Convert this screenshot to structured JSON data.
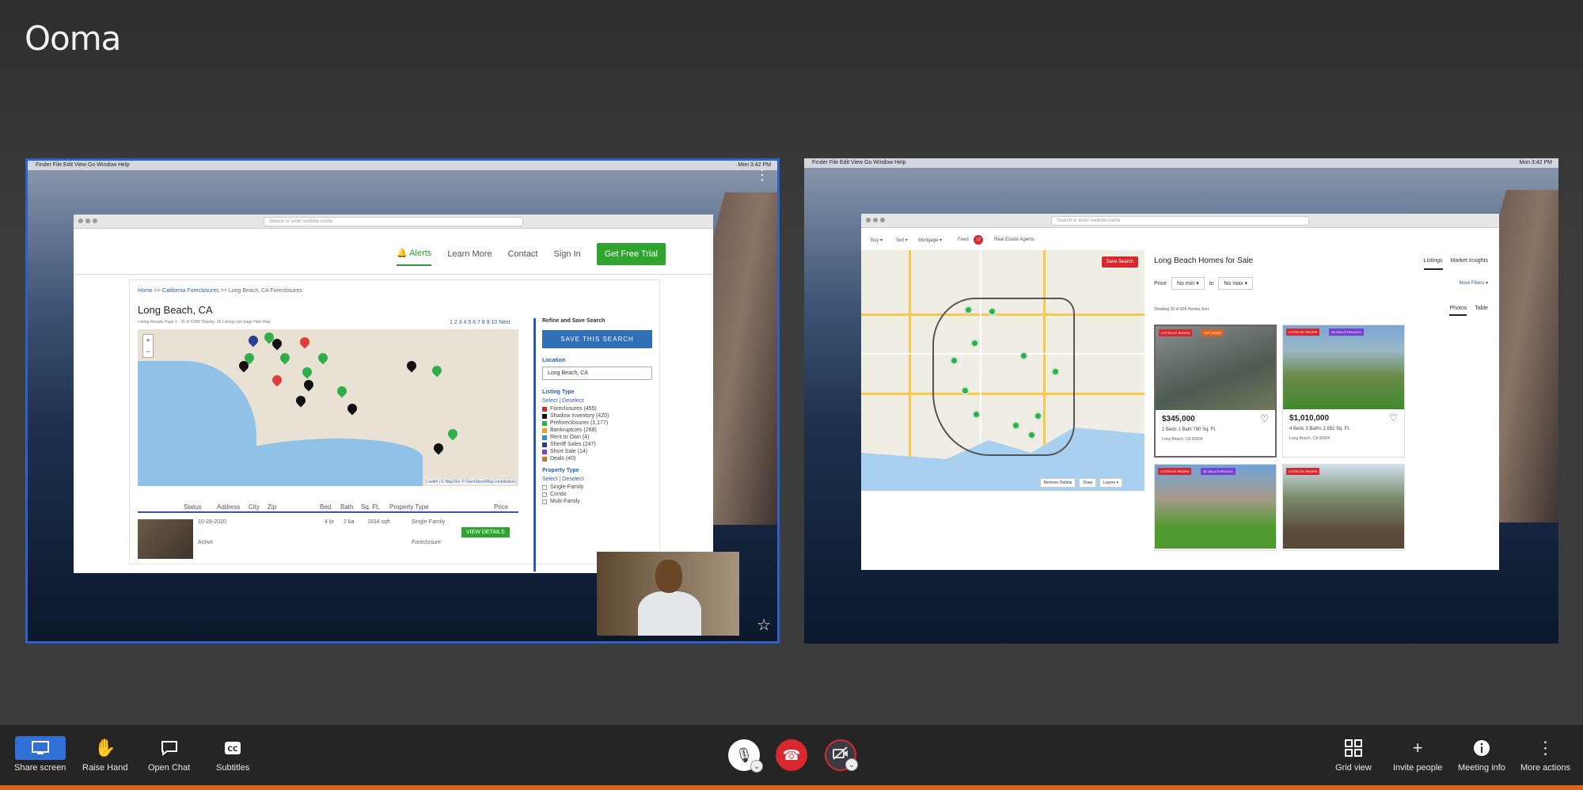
{
  "brand": {
    "logo": "Ooma"
  },
  "left_tile": {
    "menu_bar": "Finder  File  Edit  View  Go  Window  Help",
    "menu_bar_right": "Mon 3:42 PM",
    "url_placeholder": "Search or enter website name",
    "nav": {
      "alerts": "Alerts",
      "learn_more": "Learn More",
      "contact": "Contact",
      "sign_in": "Sign In",
      "cta": "Get Free Trial"
    },
    "breadcrumb": {
      "home": "Home",
      "sep1": ">>",
      "state": "California Foreclosures",
      "sep2": ">>",
      "current": "Long Beach, CA Foreclosures"
    },
    "city": "Long Beach, CA",
    "listing_meta": "Listing Results Page 1 - 25 of 3,899     Display: 25  Listings per page     Hide Map",
    "pagination": "1 2 3 4 5 6 7 8 9 10 Next",
    "map_credit": "Leaflet | © MapTiler © OpenStreetMap contributors",
    "zoom_in": "+",
    "zoom_out": "−",
    "table_headers": [
      "Status",
      "Address",
      "City",
      "Zip",
      "Bed",
      "Bath",
      "Sq. Ft.",
      "Property Type",
      "Price"
    ],
    "row": {
      "date": "10-28-2020",
      "status": "Active",
      "bed": "4 br",
      "bath": "2 ba",
      "sqft": "1834 sqft",
      "type": "Single-Family",
      "type2": "Foreclosure",
      "button": "VIEW DETAILS"
    },
    "sidebar": {
      "title": "Refine and Save Search",
      "save_button": "SAVE THIS SEARCH",
      "location_label": "Location",
      "location_value": "Long Beach, CA",
      "listing_type_label": "Listing Type",
      "select_deselect": "Select | Deselect",
      "listing_types": [
        {
          "label": "Foreclosures (455)",
          "color": "#d7282f"
        },
        {
          "label": "Shadow Inventory (420)",
          "color": "#111111"
        },
        {
          "label": "Preforeclosures (1,177)",
          "color": "#2fae4a"
        },
        {
          "label": "Bankruptcies (268)",
          "color": "#f0a020"
        },
        {
          "label": "Rent to Own (4)",
          "color": "#2a8fd6"
        },
        {
          "label": "Sheriff Sales (247)",
          "color": "#2b3f8f"
        },
        {
          "label": "Short Sale (14)",
          "color": "#8a3fb0"
        },
        {
          "label": "Deals (40)",
          "color": "#c8741e"
        }
      ],
      "property_type_label": "Property Type",
      "property_select": "Select | Deselect",
      "property_types": [
        "Single-Family",
        "Condo",
        "Multi-Family"
      ]
    },
    "more_icon": "⋮",
    "star_icon": "☆"
  },
  "right_tile": {
    "menu_bar": "Finder  File  Edit  View  Go  Window  Help",
    "menu_bar_right": "Mon 3:42 PM",
    "url_placeholder": "Search or enter website name",
    "nav": {
      "buy": "Buy ▾",
      "sell": "Sell ▾",
      "mortgage": "Mortgage ▾",
      "feed": "Feed",
      "feed_badge": "12",
      "agents": "Real Estate Agents"
    },
    "save_search": "Save Search",
    "map_buttons": [
      "Remove Outline",
      "Draw",
      "Layers ▾"
    ],
    "heading": "Long Beach Homes for Sale",
    "tabs": [
      "Listings",
      "Market Insights"
    ],
    "price_label": "Price",
    "min": "No min",
    "to": "to",
    "max": "No max",
    "more_filters": "More Filters ▾",
    "showing": "Showing 25 of 826 Homes     Sort",
    "view_tabs": [
      "Photos",
      "Table"
    ],
    "cards": [
      {
        "badges": [
          "LISTED BY REDFIN",
          "HOT HOME"
        ],
        "price": "$345,000",
        "facts": "2 Beds   1 Bath   780 Sq. Ft.",
        "address": "Long Beach, CA 90804"
      },
      {
        "badges": [
          "LISTED BY REDFIN",
          "3D WALKTHROUGH"
        ],
        "price": "$1,010,000",
        "facts": "4 Beds   3 Baths   2,652 Sq. Ft.",
        "address": "Long Beach, CA 90804"
      },
      {
        "badges": [
          "LISTED BY REDFIN",
          "3D WALKTHROUGH"
        ],
        "price": "",
        "facts": "",
        "address": ""
      },
      {
        "badges": [
          "LISTED BY REDFIN"
        ],
        "price": "",
        "facts": "",
        "address": ""
      }
    ]
  },
  "toolbar": {
    "share_screen": "Share screen",
    "raise_hand": "Raise Hand",
    "open_chat": "Open Chat",
    "subtitles": "Subtitles",
    "grid_view": "Grid view",
    "invite_people": "Invite people",
    "meeting_info": "Meeting info",
    "more_actions": "More actions"
  },
  "colors": {
    "accent": "#2f6fd6",
    "end_call": "#d7282f",
    "bottom_edge": "#e0641e"
  }
}
